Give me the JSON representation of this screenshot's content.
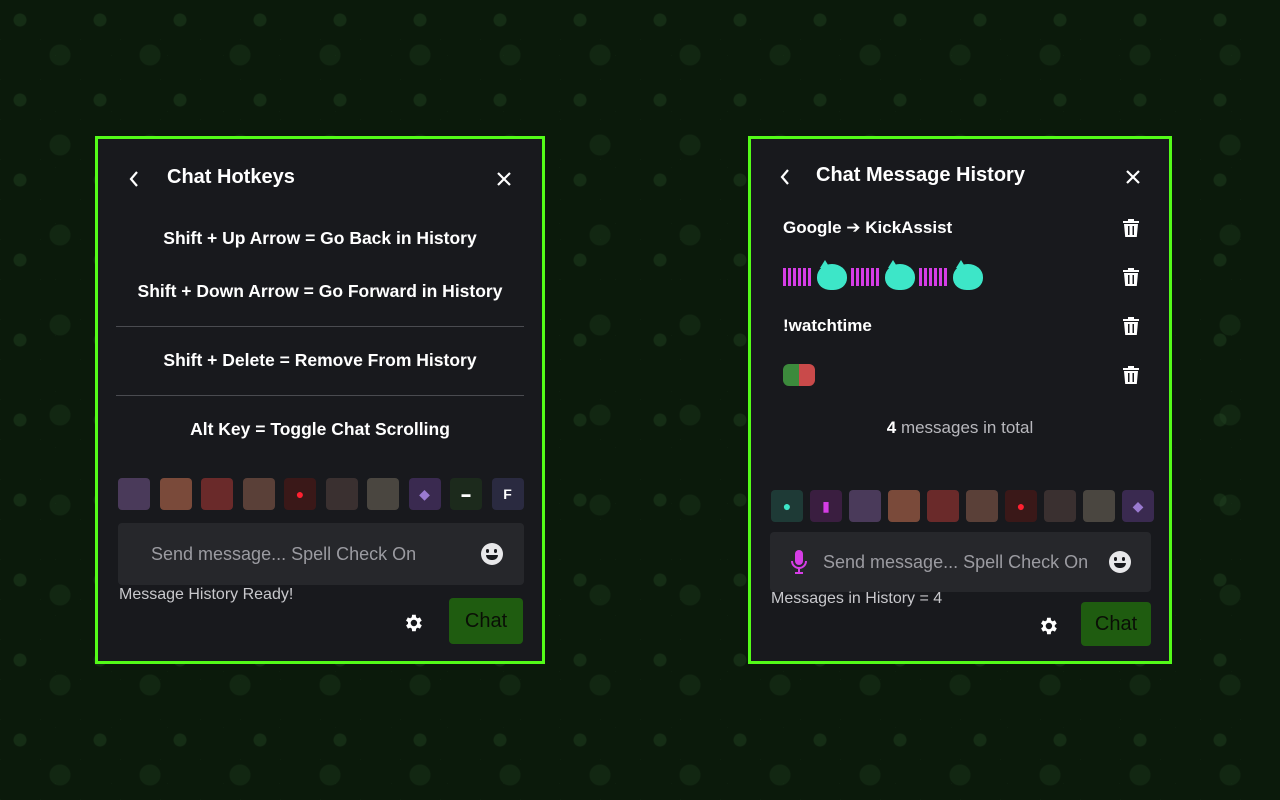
{
  "colors": {
    "accent": "#53fc18",
    "panel_bg": "#18191d",
    "chat_button": "#1f5c10"
  },
  "hotkeys_panel": {
    "title": "Chat Hotkeys",
    "hotkeys": [
      "Shift + Up Arrow = Go Back in History",
      "Shift + Down Arrow = Go Forward in History",
      "Shift + Delete = Remove From History",
      "Alt Key = Toggle Chat Scrolling"
    ],
    "emotes": [
      "emote-1",
      "emote-2",
      "emote-3",
      "emote-4",
      "emote-5",
      "emote-6",
      "emote-7",
      "emote-8",
      "emote-9",
      "emote-10"
    ],
    "input_placeholder": "Send message... Spell Check On",
    "status": "Message History Ready!",
    "chat_button": "Chat"
  },
  "history_panel": {
    "title": "Chat Message History",
    "messages": [
      {
        "text": "Google ➔ KickAssist"
      },
      {
        "text": ""
      },
      {
        "text": "!watchtime"
      },
      {
        "text": ""
      }
    ],
    "total_count": "4",
    "total_suffix": " messages in total",
    "emotes": [
      "emote-1",
      "emote-2",
      "emote-3",
      "emote-4",
      "emote-5",
      "emote-6",
      "emote-7",
      "emote-8",
      "emote-9",
      "emote-10"
    ],
    "input_placeholder": "Send message... Spell Check On",
    "status": "Messages in History = 4",
    "chat_button": "Chat"
  }
}
